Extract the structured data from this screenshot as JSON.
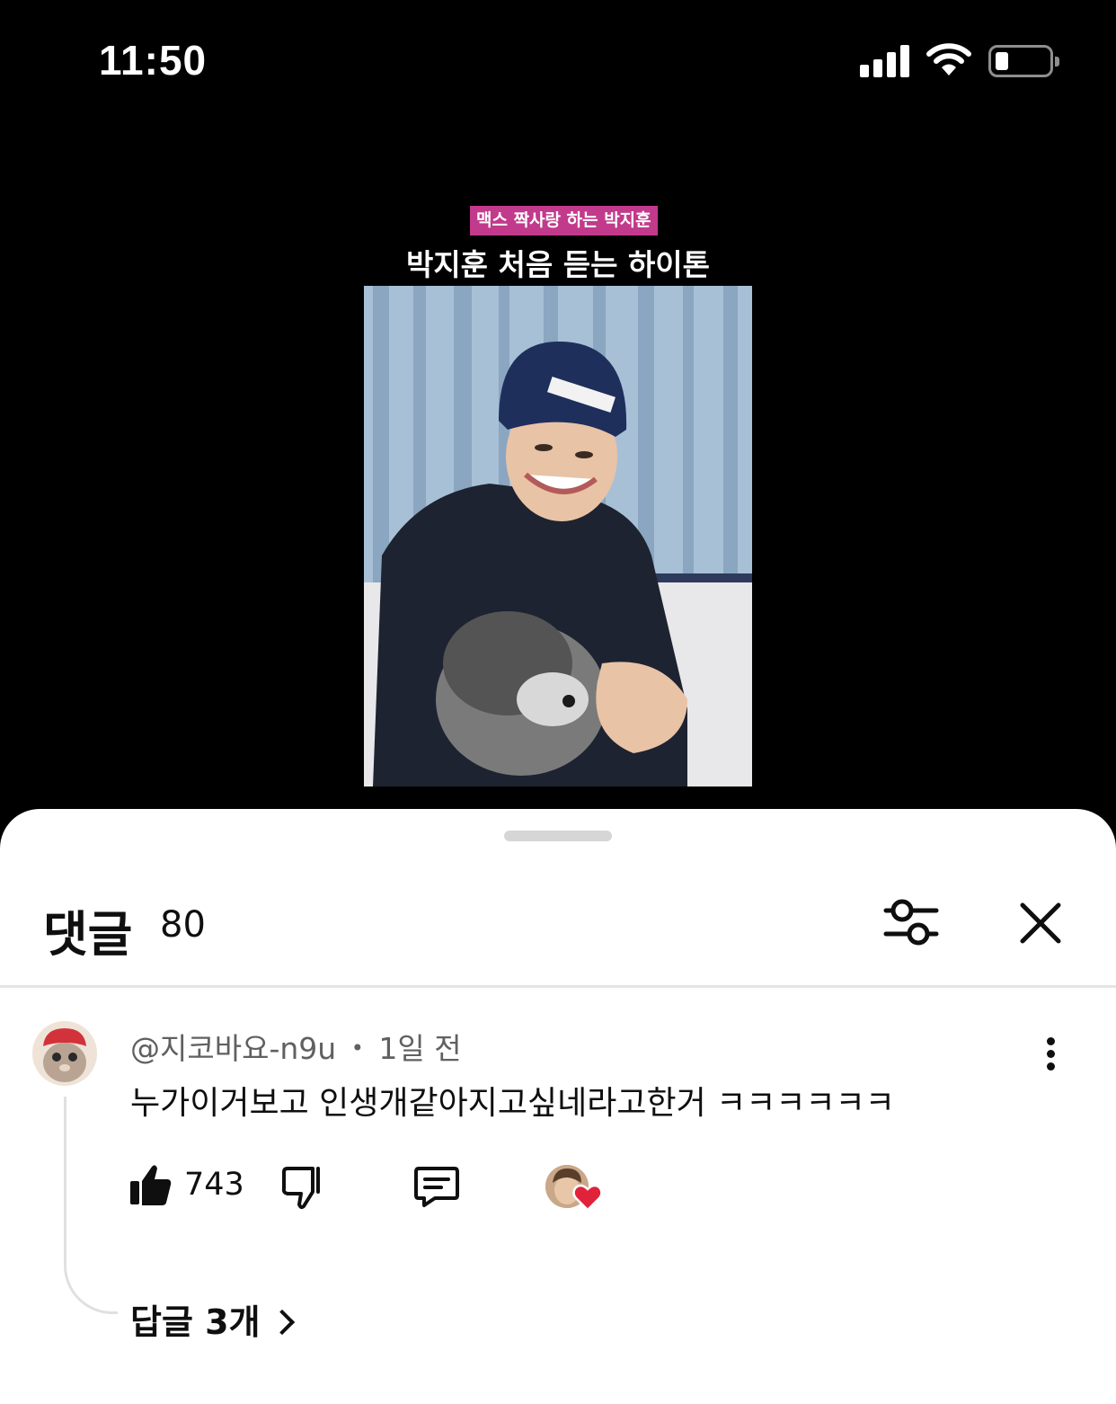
{
  "status_bar": {
    "time": "11:50",
    "battery_level": 0.2
  },
  "video": {
    "tag": "맥스 짝사랑 하는 박지훈",
    "title": "박지훈 처음 듣는 하이톤"
  },
  "comments_sheet": {
    "title": "댓글",
    "count": "80",
    "comment": {
      "author": "@지코바요-n9u",
      "separator": "•",
      "time": "1일 전",
      "text": "누가이거보고 인생개같아지고싶네라고한거 ㅋㅋㅋㅋㅋㅋ",
      "likes": "743",
      "creator_hearted": true
    },
    "replies_label": "답글 3개"
  },
  "colors": {
    "tag_bg": "#c23a8b",
    "heart": "#e0233b",
    "text": "#0f0f0f",
    "meta": "#606060"
  },
  "icons": [
    "signal-icon",
    "wifi-icon",
    "battery-icon",
    "filter-icon",
    "close-icon",
    "more-vert-icon",
    "thumb-up-icon",
    "thumb-down-icon",
    "reply-icon",
    "heart-icon",
    "chevron-right-icon"
  ]
}
